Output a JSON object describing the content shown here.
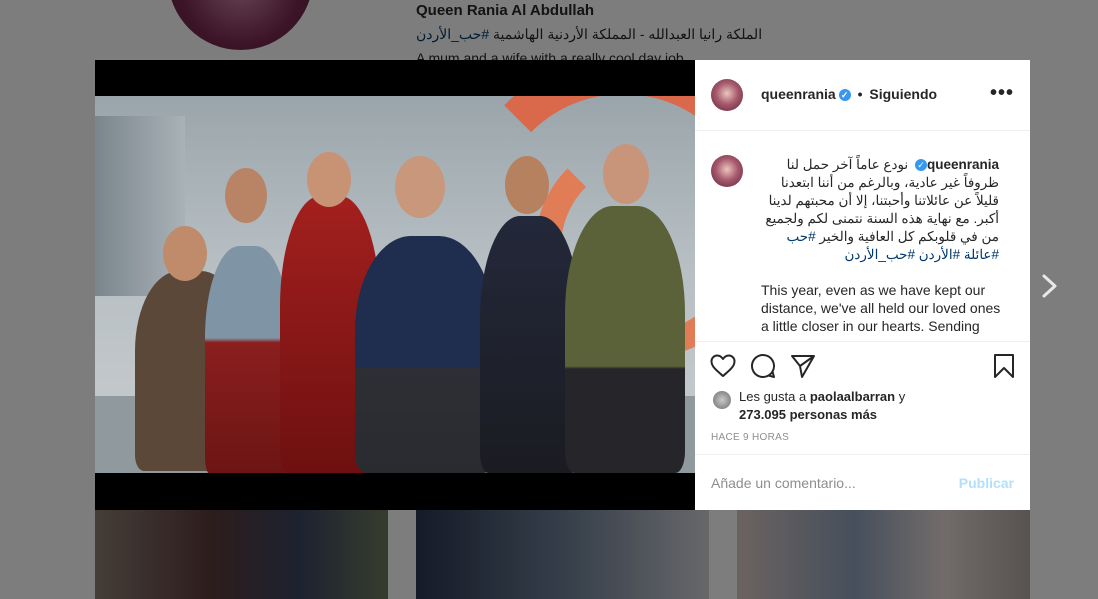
{
  "profile": {
    "display_name": "Queen Rania Al Abdullah",
    "bio_arabic": "الملكة رانيا العبدالله - المملكة الأردنية الهاشمية",
    "bio_hashtag": "#حب_الأردن",
    "bio_line2": "A mum and a wife with a really cool day job."
  },
  "post": {
    "username": "queenrania",
    "verified_mark": "✓",
    "separator": "•",
    "follow_status": "Siguiendo",
    "more_icon": "•••",
    "caption_arabic": "نودع عاماً آخر حمل لنا ظروفاً غير عادية، وبالرغم من أننا ابتعدنا قليلاً عن عائلاتنا وأحبتنا، إلا أن محبتهم لدينا أكبر. مع نهاية هذه السنة نتمنى لكم ولجميع من في قلوبكم كل العافية والخير",
    "caption_hashtags": "#حب #عائلة #الأردن #حب_الأردن",
    "caption_english": "This year, even as we have kept our distance, we've all held our loved ones a little closer in our hearts. Sending",
    "likes_prefix": "Les gusta a",
    "likes_user": "paolaalbarran",
    "likes_conj": "y",
    "likes_count": "273.095 personas más",
    "timestamp": "HACE 9 HORAS",
    "comment_placeholder": "Añade un comentario...",
    "publish_label": "Publicar"
  },
  "icons": {
    "like": "heart-icon",
    "comment": "comment-icon",
    "share": "share-icon",
    "save": "bookmark-icon",
    "next": "chevron-right-icon"
  },
  "colors": {
    "link": "#00376b",
    "verified": "#3897f0",
    "publish_disabled": "#b2dffc"
  }
}
